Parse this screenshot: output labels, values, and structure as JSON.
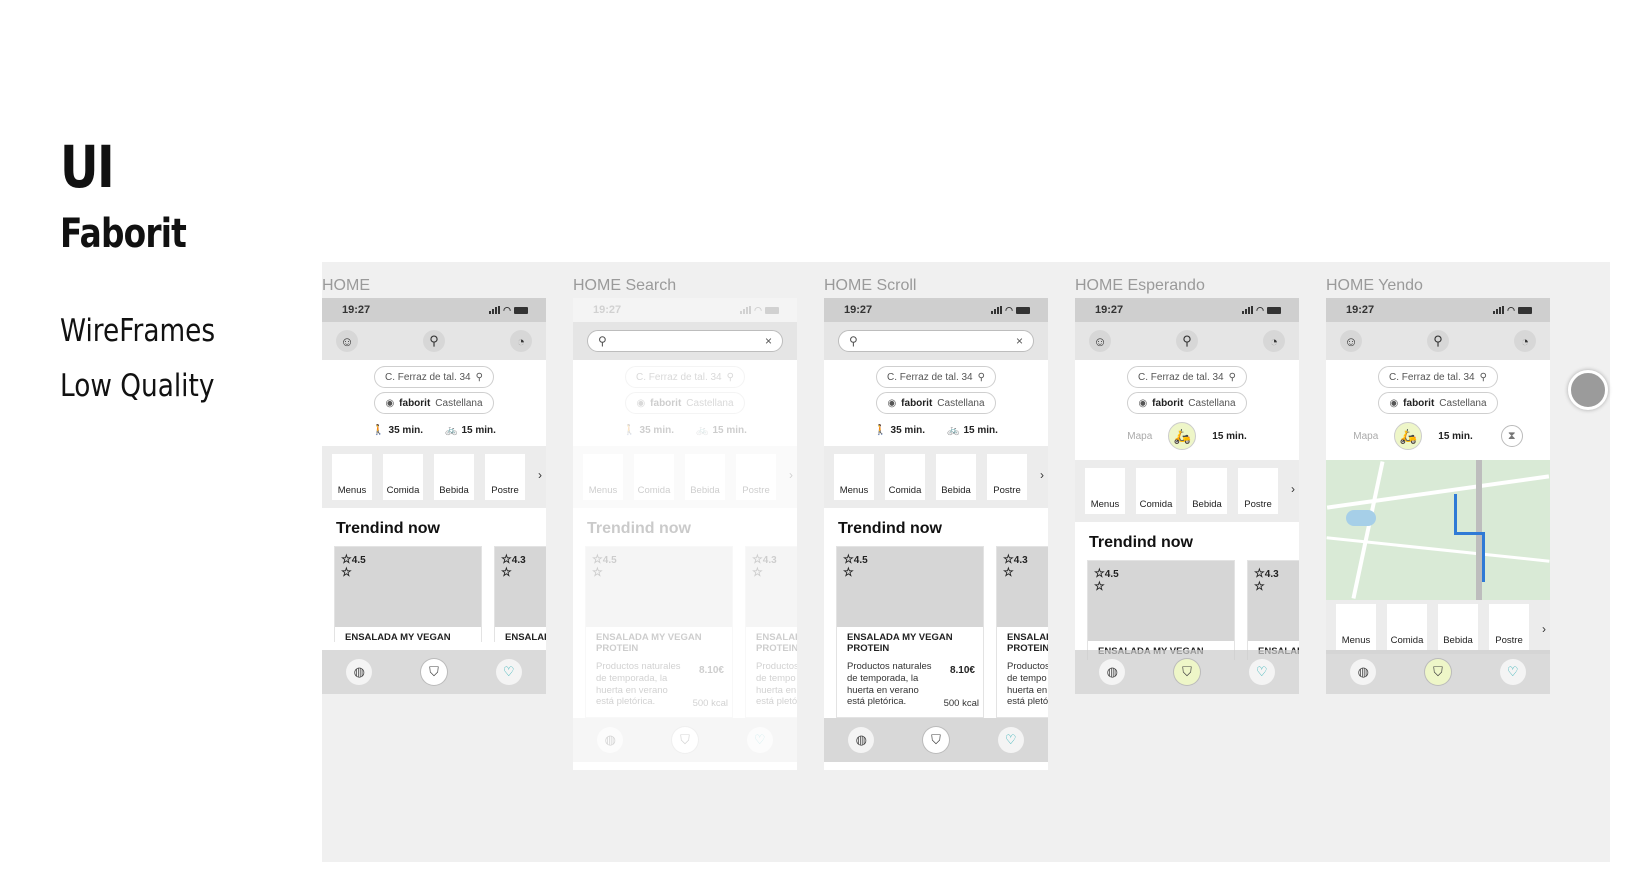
{
  "heading": {
    "title": "UI",
    "brand": "Faborit",
    "line1": "WireFrames",
    "line2": "Low Quality"
  },
  "common": {
    "time": "19:27",
    "address": "C. Ferraz de tal. 34",
    "store_brand": "faborit",
    "store_name": "Castellana",
    "walk_time": "35 min.",
    "bike_time": "15 min.",
    "map_label": "Mapa",
    "categories": [
      "Menus",
      "Comida",
      "Bebida",
      "Postre"
    ],
    "trending_title": "Trendind now",
    "card1": {
      "rating": "4.5",
      "name_line1": "ENSALADA MY VEGAN",
      "name_line2": "PROTEIN",
      "desc1": "Productos naturales",
      "desc2": "de temporada, la",
      "desc3": "huerta en verano",
      "desc4": "está pletórica.",
      "price": "8.10€",
      "kcal": "500 kcal"
    },
    "card2": {
      "rating": "4.3",
      "name_line1": "ENSALADA",
      "name_line2": "PROTEIN",
      "desc1": "Productos",
      "desc2": "de tempo",
      "desc3": "huerta en",
      "desc4": "está pletó"
    }
  },
  "frames": [
    {
      "label": "HOME"
    },
    {
      "label": "HOME Search"
    },
    {
      "label": "HOME Scroll"
    },
    {
      "label": "HOME Esperando"
    },
    {
      "label": "HOME Yendo"
    }
  ],
  "icons": {
    "signal": "signal-icon",
    "wifi": "wifi-icon",
    "battery": "battery-icon",
    "profile": "profile-icon",
    "search": "search-icon",
    "notifications": "bell-icon",
    "walk": "walk-icon",
    "bike": "bike-icon",
    "location_pin": "pin-icon",
    "store_logo": "store-logo-icon",
    "star": "star-icon",
    "home_nav": "globe-icon",
    "basket": "basket-icon",
    "favorites": "heart-icon",
    "clear": "close-icon"
  },
  "colors": {
    "canvas_bg": "#f0f0f0",
    "accent_heart": "#22aab0",
    "highlight": "#eef6c8",
    "route_blue": "#2f7ad6"
  }
}
